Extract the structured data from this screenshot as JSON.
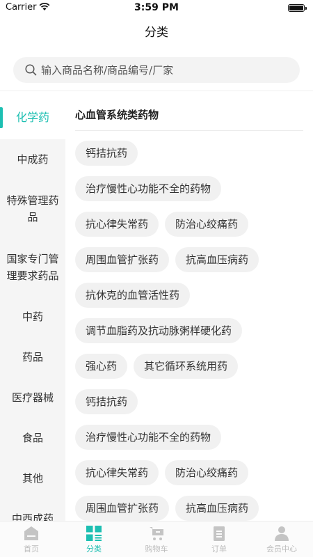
{
  "status_bar": {
    "carrier": "Carrier",
    "time": "3:59 PM"
  },
  "nav": {
    "title": "分类"
  },
  "search": {
    "placeholder": "输入商品名称/商品编号/厂家"
  },
  "sidebar": {
    "items": [
      {
        "label": "化学药",
        "active": true
      },
      {
        "label": "中成药"
      },
      {
        "label": "特殊管理药品"
      },
      {
        "label": "国家专门管理要求药品"
      },
      {
        "label": "中药"
      },
      {
        "label": "药品"
      },
      {
        "label": "医疗器械"
      },
      {
        "label": "食品"
      },
      {
        "label": "其他"
      },
      {
        "label": "中西成药"
      }
    ]
  },
  "content": {
    "title": "心血管系统类药物",
    "chip_rows": [
      [
        "钙拮抗药"
      ],
      [
        "治疗慢性心功能不全的药物"
      ],
      [
        "抗心律失常药",
        "防治心绞痛药"
      ],
      [
        "周围血管扩张药",
        "抗高血压病药"
      ],
      [
        "抗休克的血管活性药"
      ],
      [
        "调节血脂药及抗动脉粥样硬化药"
      ],
      [
        "强心药",
        "其它循环系统用药"
      ],
      [
        "钙拮抗药"
      ],
      [
        "治疗慢性心功能不全的药物"
      ],
      [
        "抗心律失常药",
        "防治心绞痛药"
      ],
      [
        "周围血管扩张药",
        "抗高血压病药"
      ]
    ]
  },
  "tabbar": {
    "tabs": [
      {
        "label": "首页",
        "icon": "home-icon"
      },
      {
        "label": "分类",
        "icon": "category-icon",
        "active": true
      },
      {
        "label": "购物车",
        "icon": "cart-icon"
      },
      {
        "label": "订单",
        "icon": "order-icon"
      },
      {
        "label": "会员中心",
        "icon": "member-icon"
      }
    ]
  },
  "colors": {
    "accent": "#1dbfb2",
    "inactive": "#bdbdbd",
    "sidebar_bg": "#f5f5f5",
    "chip_bg": "#f1f1f1"
  }
}
